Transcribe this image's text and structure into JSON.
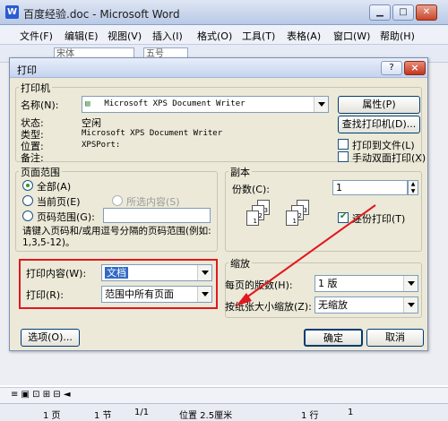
{
  "window": {
    "title": "百度经验.doc - Microsoft Word",
    "icon_glyph": "W"
  },
  "menu": [
    "文件(F)",
    "编辑(E)",
    "视图(V)",
    "插入(I)",
    "格式(O)",
    "工具(T)",
    "表格(A)",
    "窗口(W)",
    "帮助(H)"
  ],
  "toolbar": {
    "font": "宋体",
    "size": "五号"
  },
  "dialog": {
    "title": "打印",
    "help": "?",
    "close": "×",
    "printer": {
      "group_title": "打印机",
      "name_label": "名称(N):",
      "name_value": "Microsoft XPS Document Writer",
      "properties_button": "属性(P)",
      "find_button": "查找打印机(D)...",
      "status_label": "状态:",
      "status_value": "空闲",
      "type_label": "类型:",
      "type_value": "Microsoft XPS Document Writer",
      "location_label": "位置:",
      "location_value": "XPSPort:",
      "comment_label": "备注:",
      "print_to_file": "打印到文件(L)",
      "manual_duplex": "手动双面打印(X)"
    },
    "page_range": {
      "group_title": "页面范围",
      "all": "全部(A)",
      "current": "当前页(E)",
      "selection": "所选内容(S)",
      "pages": "页码范围(G):",
      "hint": "请键入页码和/或用逗号分隔的页码范围(例如: 1,3,5-12)。"
    },
    "copies": {
      "group_title": "副本",
      "count_label": "份数(C):",
      "count_value": "1",
      "collate": "逐份打印(T)",
      "stack_pages": [
        "1",
        "2",
        "3"
      ]
    },
    "print_what_label": "打印内容(W):",
    "print_what_value": "文档",
    "print_label": "打印(R):",
    "print_value": "范围中所有页面",
    "zoom": {
      "group_title": "缩放",
      "pages_per_sheet_label": "每页的版数(H):",
      "pages_per_sheet_value": "1 版",
      "scale_label": "按纸张大小缩放(Z):",
      "scale_value": "无缩放"
    },
    "options_button": "选项(O)...",
    "ok_button": "确定",
    "cancel_button": "取消"
  },
  "statusbar": {
    "page": "1 页",
    "section": "1 节",
    "ratio": "1/1",
    "position": "位置 2.5厘米",
    "line": "1 行",
    "column": "1"
  },
  "colors": {
    "highlight": "#e0181e",
    "selection": "#316ac5"
  }
}
